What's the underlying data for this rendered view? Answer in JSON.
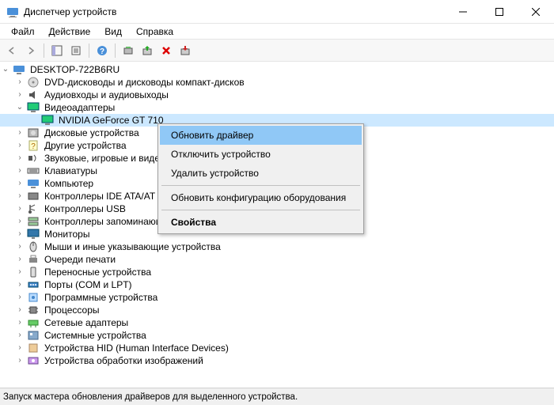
{
  "window": {
    "title": "Диспетчер устройств"
  },
  "menu": {
    "file": "Файл",
    "action": "Действие",
    "view": "Вид",
    "help": "Справка"
  },
  "tree": {
    "root": "DESKTOP-722B6RU",
    "nodes": [
      {
        "label": "DVD-дисководы и дисководы компакт-дисков",
        "icon": "disc"
      },
      {
        "label": "Аудиовходы и аудиовыходы",
        "icon": "audio"
      },
      {
        "label": "Видеоадаптеры",
        "icon": "display",
        "expanded": true,
        "children": [
          {
            "label": "NVIDIA GeForce GT 710",
            "icon": "display",
            "selected": true
          }
        ]
      },
      {
        "label": "Дисковые устройства",
        "icon": "disk"
      },
      {
        "label": "Другие устройства",
        "icon": "unknown"
      },
      {
        "label": "Звуковые, игровые и виде",
        "icon": "sound",
        "clipped": true
      },
      {
        "label": "Клавиатуры",
        "icon": "keyboard"
      },
      {
        "label": "Компьютер",
        "icon": "computer"
      },
      {
        "label": "Контроллеры IDE ATA/AT",
        "icon": "ide",
        "clipped": true
      },
      {
        "label": "Контроллеры USB",
        "icon": "usb"
      },
      {
        "label": "Контроллеры запоминающих устройств",
        "icon": "storage"
      },
      {
        "label": "Мониторы",
        "icon": "monitor"
      },
      {
        "label": "Мыши и иные указывающие устройства",
        "icon": "mouse"
      },
      {
        "label": "Очереди печати",
        "icon": "printer"
      },
      {
        "label": "Переносные устройства",
        "icon": "portable"
      },
      {
        "label": "Порты (COM и LPT)",
        "icon": "port"
      },
      {
        "label": "Программные устройства",
        "icon": "software"
      },
      {
        "label": "Процессоры",
        "icon": "cpu"
      },
      {
        "label": "Сетевые адаптеры",
        "icon": "network"
      },
      {
        "label": "Системные устройства",
        "icon": "system"
      },
      {
        "label": "Устройства HID (Human Interface Devices)",
        "icon": "hid"
      },
      {
        "label": "Устройства обработки изображений",
        "icon": "imaging"
      }
    ]
  },
  "context_menu": {
    "update_driver": "Обновить драйвер",
    "disable": "Отключить устройство",
    "uninstall": "Удалить устройство",
    "scan": "Обновить конфигурацию оборудования",
    "properties": "Свойства"
  },
  "statusbar": "Запуск мастера обновления драйверов для выделенного устройства."
}
